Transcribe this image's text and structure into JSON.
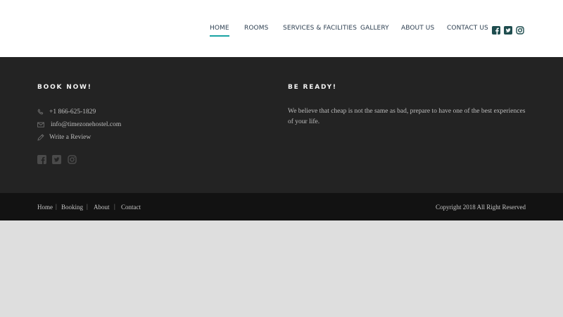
{
  "header": {
    "nav": [
      {
        "label": "HOME",
        "active": true
      },
      {
        "label": "ROOMS",
        "active": false
      },
      {
        "label": "SERVICES & FACILITIES",
        "active": false
      },
      {
        "label": "GALLERY",
        "active": false
      },
      {
        "label": "ABOUT US",
        "active": false
      },
      {
        "label": "CONTACT US",
        "active": false
      }
    ],
    "social_icons": [
      "facebook-icon",
      "twitter-icon",
      "instagram-icon"
    ]
  },
  "footer": {
    "book": {
      "title": "BOOK NOW!",
      "phone": "+1 866-625-1829",
      "email": "info@timezonehostel.com",
      "review": "Write a Review",
      "icons": [
        "phone-icon",
        "envelope-icon",
        "pencil-icon"
      ],
      "social_icons": [
        "facebook-icon",
        "twitter-icon",
        "instagram-icon"
      ]
    },
    "ready": {
      "title": "BE READY!",
      "text": "We believe that cheap is not the same as bad, prepare to have one of the best experiences of your life."
    }
  },
  "bottom": {
    "links": [
      "Home",
      "Booking",
      "About",
      "Contact"
    ],
    "separator": "|",
    "copyright": "Copyright 2018 All Right Reserved"
  },
  "colors": {
    "accent": "#1aa3a3",
    "nav_text": "#2c3e50",
    "footer_bg": "#232323",
    "bottom_bg": "#121212",
    "page_bg": "#dedede"
  }
}
